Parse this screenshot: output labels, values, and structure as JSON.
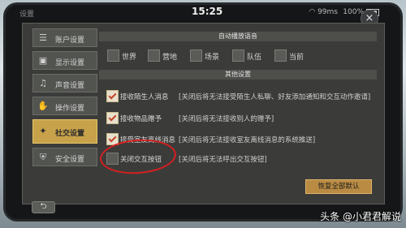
{
  "status": {
    "title": "设置",
    "time": "15:25",
    "wifi": "99ms",
    "battery": "100%"
  },
  "close_label": "×",
  "sidebar": {
    "items": [
      {
        "label": "账户设置",
        "icon": "☰"
      },
      {
        "label": "显示设置",
        "icon": "▣"
      },
      {
        "label": "声音设置",
        "icon": "♫"
      },
      {
        "label": "操作设置",
        "icon": "✋"
      },
      {
        "label": "社交设置",
        "icon": "✦",
        "active": true
      },
      {
        "label": "安全设置",
        "icon": "⛨"
      }
    ]
  },
  "auto_voice": {
    "title": "自动播放语音",
    "options": [
      "世界",
      "营地",
      "场景",
      "队伍",
      "当前"
    ]
  },
  "other": {
    "title": "其他设置",
    "rows": [
      {
        "label": "接收陌生人消息",
        "desc": "[关闭后将无法接受陌生人私聊、好友添加通知和交互动作邀请]",
        "checked": true
      },
      {
        "label": "接收物品赠予",
        "desc": "[关闭后将无法接收别人的赠予]",
        "checked": true
      },
      {
        "label": "接受室友离线消息",
        "desc": "[关闭后将无法接收室友离线消息的系统推送]",
        "checked": true
      },
      {
        "label": "关闭交互按钮",
        "desc": "[关闭后将无法呼出交互按钮]",
        "checked": false
      }
    ]
  },
  "reset_label": "恢复全部默认",
  "back_label": "⮌",
  "watermark": "头条 @小君君解说",
  "colors": {
    "active_tab": "#c7a24a",
    "reset_button": "#b98b43",
    "annotation": "#d81f1f",
    "check": "#c4442a"
  }
}
